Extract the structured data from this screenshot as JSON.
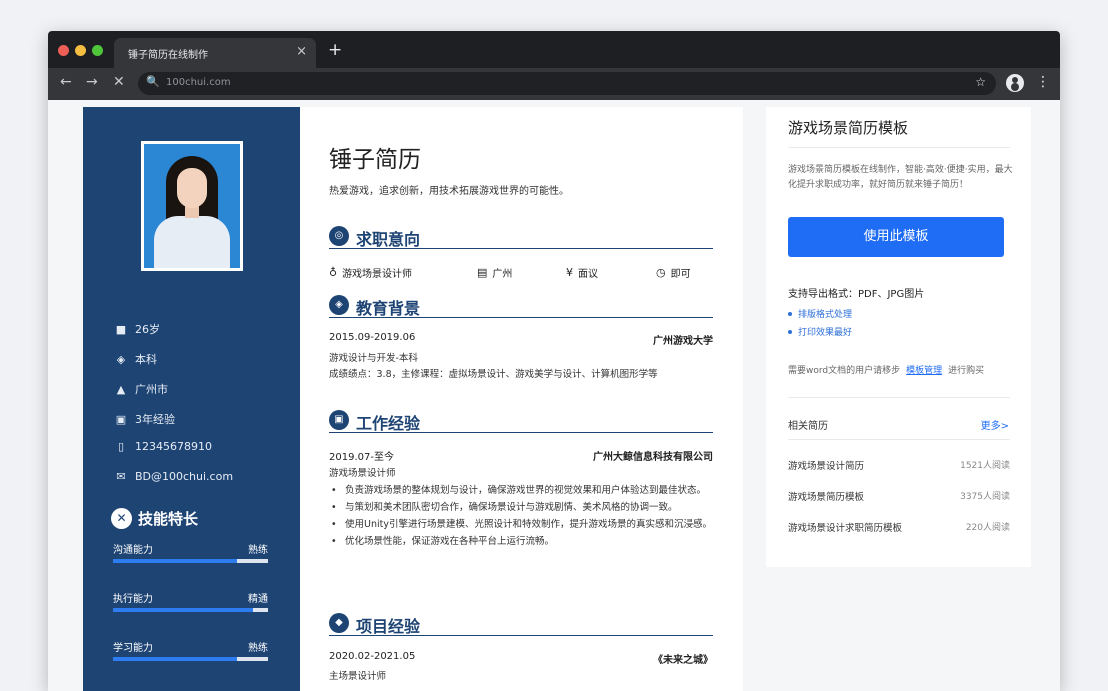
{
  "browser": {
    "tab_title": "锤子简历在线制作",
    "tab_close": "×",
    "new_tab": "+",
    "back": "←",
    "forward": "→",
    "stop": "✕",
    "url": "100chui.com",
    "search_glyph": "🔍",
    "star": "☆",
    "menu": "⋮"
  },
  "sidebar": {
    "info": [
      {
        "icon": "user-icon",
        "glyph": "■",
        "text": "26岁"
      },
      {
        "icon": "education-icon",
        "glyph": "◈",
        "text": "本科"
      },
      {
        "icon": "location-icon",
        "glyph": "▲",
        "text": "广州市"
      },
      {
        "icon": "experience-icon",
        "glyph": "▣",
        "text": "3年经验"
      },
      {
        "icon": "phone-icon",
        "glyph": "▯",
        "text": "12345678910"
      },
      {
        "icon": "email-icon",
        "glyph": "✉",
        "text": "BD@100chui.com"
      }
    ],
    "skills_title": "技能特长",
    "skills_glyph": "✕",
    "skills": [
      {
        "name": "沟通能力",
        "level": "熟练",
        "fraction": 0.8
      },
      {
        "name": "执行能力",
        "level": "精通",
        "fraction": 0.9
      },
      {
        "name": "学习能力",
        "level": "熟练",
        "fraction": 0.8
      }
    ]
  },
  "resume": {
    "name": "锤子简历",
    "slogan": "热爱游戏，追求创新，用技术拓展游戏世界的可能性。",
    "sections": {
      "intent": "求职意向",
      "education": "教育背景",
      "work": "工作经验",
      "project": "项目经验"
    },
    "intent_items": [
      {
        "icon": "job-icon",
        "glyph": "♁",
        "text": "游戏场景设计师"
      },
      {
        "icon": "city-icon",
        "glyph": "▤",
        "text": "广州"
      },
      {
        "icon": "salary-icon",
        "glyph": "¥",
        "text": "面议"
      },
      {
        "icon": "time-icon",
        "glyph": "◷",
        "text": "即可"
      }
    ],
    "education": {
      "period": "2015.09-2019.06",
      "school": "广州游戏大学",
      "major": "游戏设计与开发-本科",
      "detail": "成绩绩点：3.8，主修课程：虚拟场景设计、游戏美学与设计、计算机图形学等"
    },
    "work": {
      "period": "2019.07-至今",
      "company": "广州大鲸信息科技有限公司",
      "role": "游戏场景设计师",
      "bullets": [
        "负责游戏场景的整体规划与设计，确保游戏世界的视觉效果和用户体验达到最佳状态。",
        "与策划和美术团队密切合作，确保场景设计与游戏剧情、美术风格的协调一致。",
        "使用Unity引擎进行场景建模、光照设计和特效制作，提升游戏场景的真实感和沉浸感。",
        "优化场景性能，保证游戏在各种平台上运行流畅。"
      ]
    },
    "project": {
      "period": "2020.02-2021.05",
      "name": "《未来之城》",
      "role": "主场景设计师"
    }
  },
  "panel": {
    "title": "游戏场景简历模板",
    "desc": "游戏场景简历模板在线制作，智能·高效·便捷·实用，最大化提升求职成功率，就好简历就来锤子简历！",
    "button": "使用此模板",
    "format": "支持导出格式：PDF、JPG图片",
    "features": [
      "排版格式处理",
      "打印效果最好"
    ],
    "hint_prefix": "需要word文档的用户请移步",
    "hint_link": "模板管理",
    "hint_suffix": "进行购买",
    "related": "相关简历",
    "more": "更多>",
    "items": [
      {
        "name": "游戏场景设计简历",
        "count": "1521人阅读"
      },
      {
        "name": "游戏场景简历模板",
        "count": "3375人阅读"
      },
      {
        "name": "游戏场景设计求职简历模板",
        "count": "220人阅读"
      }
    ]
  }
}
